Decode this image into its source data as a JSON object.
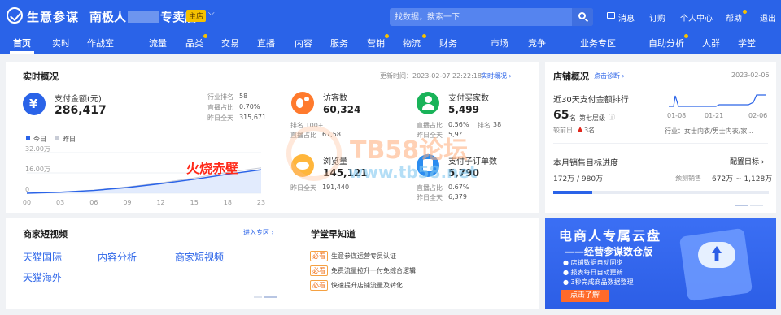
{
  "topbar": {
    "brand": "生意参谋",
    "store_prefix": "南极人",
    "store_suffix": "专卖店",
    "store_badge": "主店",
    "search_placeholder": "找数据，搜索一下",
    "links": [
      "消息",
      "订购",
      "个人中心",
      "帮助",
      "退出"
    ]
  },
  "nav": {
    "items": [
      "首页",
      "实时",
      "作战室",
      "流量",
      "品类",
      "交易",
      "直播",
      "内容",
      "服务",
      "营销",
      "物流",
      "财务",
      "市场",
      "竞争",
      "业务专区",
      "自助分析",
      "人群",
      "学堂"
    ],
    "active": "首页"
  },
  "realtime": {
    "title": "实时概况",
    "update_time": "更新时间：2023-02-07 22:22:18",
    "detail_link": "实时概况",
    "pay_amount": {
      "label": "支付金额(元)",
      "value": "286,417",
      "rank_label": "行业排名",
      "rank_value": "58",
      "live_label": "直播占比",
      "live_value": "0.70%",
      "yesterday_label": "昨日全天",
      "yesterday_value": "315,671"
    },
    "visitors": {
      "label": "访客数",
      "value": "60,324",
      "rank_text": "排名 100+",
      "live_label": "直播占比",
      "yesterday_label": "昨日全天",
      "yesterday_value": "67,581"
    },
    "buyers": {
      "label": "支付买家数",
      "value": "5,499",
      "live_label": "直播占比",
      "live_value": "0.56%",
      "rank_label": "排名",
      "rank_value": "38",
      "yesterday_label": "昨日全天",
      "yesterday_value": "5,9?"
    },
    "pageviews": {
      "label": "浏览量",
      "value": "145,121",
      "yesterday_label": "昨日全天",
      "yesterday_value": "191,440"
    },
    "orders": {
      "label": "支付子订单数",
      "value": "5,790",
      "live_label": "直播占比",
      "live_value": "0.67%",
      "yesterday_label": "昨日全天",
      "yesterday_value": "6,379"
    }
  },
  "chart_data": {
    "type": "area",
    "legend": [
      "今日",
      "昨日"
    ],
    "x": [
      "00",
      "03",
      "06",
      "09",
      "12",
      "15",
      "18",
      "23"
    ],
    "series": [
      {
        "name": "今日",
        "values": [
          0,
          0.8,
          2.2,
          4.5,
          7.5,
          11,
          15,
          18.5
        ]
      },
      {
        "name": "昨日",
        "values": [
          0,
          0.9,
          2.5,
          5,
          8.2,
          12,
          16.5,
          20
        ]
      }
    ],
    "yticks": [
      "32.00万",
      "16.00万",
      "0"
    ],
    "ylim": [
      0,
      32
    ]
  },
  "overlay_text": "火烧赤壁",
  "watermark": {
    "main": "TB58论坛",
    "url": "www.tb58.net"
  },
  "shop_overview": {
    "title": "店铺概况",
    "diagnose_link": "点击诊断",
    "date": "2023-02-06",
    "rank_title": "近30天支付金额排行",
    "rank_value": "65",
    "rank_unit": "名",
    "tier": "第七层级",
    "prev_label": "较前日",
    "prev_change": "3名",
    "spark_x": [
      "01-08",
      "01-21",
      "02-06"
    ],
    "industry": "行业：女士内衣/男士内衣/家...",
    "target_title": "本月销售目标进度",
    "config_link": "配置目标",
    "target_value": "172万 / 980万",
    "forecast_label": "预测销售",
    "forecast_value": "672万 ~ 1,128万",
    "progress": 0.18
  },
  "merchant_video": {
    "title": "商家短视频",
    "enter_link": "进入专区",
    "items": [
      "天猫国际",
      "内容分析",
      "商家短视频",
      "天猫海外"
    ]
  },
  "academy": {
    "title": "学堂早知道",
    "tag": "必看",
    "items": [
      "生意参谋运营专员认证",
      "免费流量拉升一付免综合逻辑",
      "快速提升店铺流量及转化"
    ]
  },
  "banner": {
    "title": "电商人专属云盘",
    "subtitle": "——经营参谋数仓版",
    "bullets": [
      "店铺数据自动同步",
      "报表每日自动更新",
      "3秒完成商品数据整理"
    ],
    "button": "点击了解"
  },
  "colors": {
    "brand": "#2a63e8",
    "accent": "#f5c100",
    "orange": "#ff6a2a"
  }
}
